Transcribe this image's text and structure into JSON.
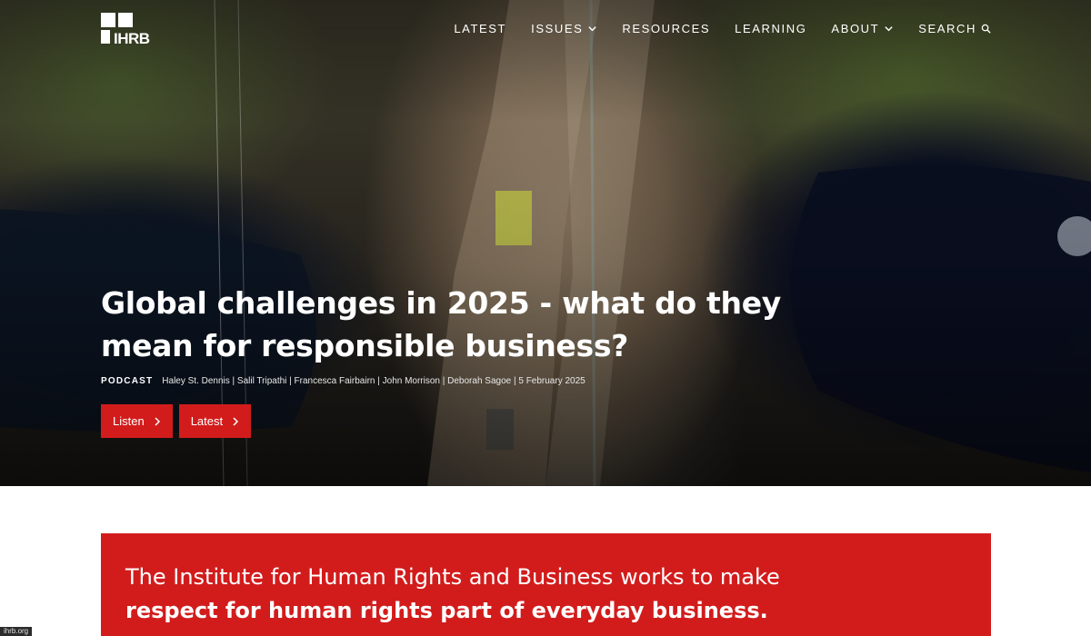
{
  "brand": {
    "logo_text": "IHRB"
  },
  "nav": {
    "items": [
      {
        "label": "LATEST",
        "has_dropdown": false
      },
      {
        "label": "ISSUES",
        "has_dropdown": true
      },
      {
        "label": "RESOURCES",
        "has_dropdown": false
      },
      {
        "label": "LEARNING",
        "has_dropdown": false
      },
      {
        "label": "ABOUT",
        "has_dropdown": true
      },
      {
        "label": "SEARCH",
        "icon": "search-icon"
      }
    ]
  },
  "hero": {
    "title": "Global challenges in 2025 - what do they mean for responsible business?",
    "type": "PODCAST",
    "authors": "Haley St. Dennis | Salil Tripathi | Francesca Fairbairn | John Morrison | Deborah Sagoe | 5 February 2025",
    "buttons": {
      "listen": "Listen",
      "latest": "Latest"
    }
  },
  "mission": {
    "line1": "The Institute for Human Rights and Business works to make",
    "line2": "respect for human rights part of everyday business."
  },
  "status_bar": {
    "url": "ihrb.org"
  },
  "colors": {
    "accent_red": "#d21c1c",
    "text_white": "#ffffff"
  }
}
